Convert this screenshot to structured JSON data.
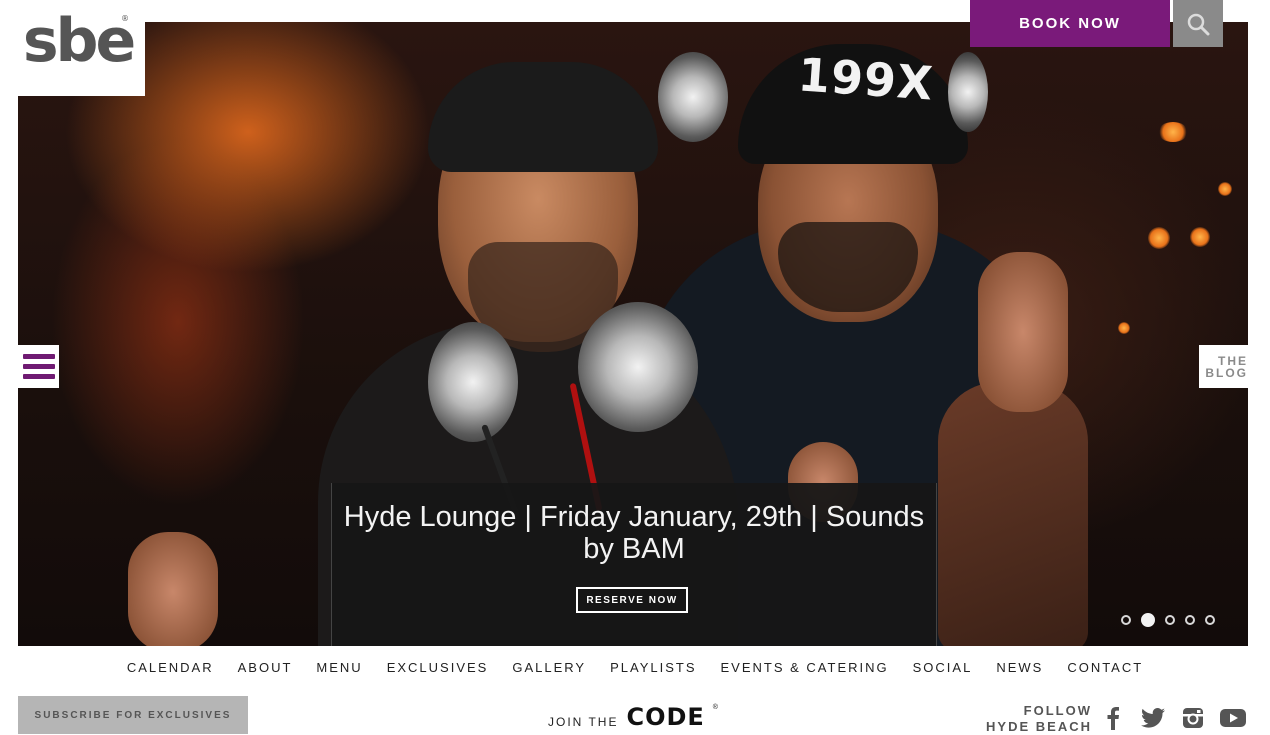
{
  "brand": {
    "logo_text": "sbe",
    "logo_mark": "®"
  },
  "header": {
    "book_now": "BOOK NOW",
    "search_icon": "search-icon"
  },
  "hero": {
    "cap_text": "199X",
    "caption_title": "Hyde Lounge | Friday January, 29th | Sounds by BAM",
    "reserve_label": "RESERVE NOW",
    "slides_count": 5,
    "active_slide": 2
  },
  "side": {
    "menu_icon": "hamburger-icon",
    "blog_line1": "THE",
    "blog_line2": "BLOG"
  },
  "nav": {
    "items": [
      "CALENDAR",
      "ABOUT",
      "MENU",
      "EXCLUSIVES",
      "GALLERY",
      "PLAYLISTS",
      "EVENTS & CATERING",
      "SOCIAL",
      "NEWS",
      "CONTACT"
    ]
  },
  "footer": {
    "subscribe": "SUBSCRIBE FOR EXCLUSIVES",
    "join_label": "JOIN THE",
    "join_brand": "CODE",
    "join_mark": "®",
    "follow_line1": "FOLLOW",
    "follow_line2": "HYDE BEACH",
    "social": [
      "facebook-icon",
      "twitter-icon",
      "instagram-icon",
      "youtube-icon"
    ]
  },
  "colors": {
    "accent": "#7a1a7a",
    "search_bg": "#8a8a8a",
    "subscribe_bg": "#b5b5b5"
  }
}
